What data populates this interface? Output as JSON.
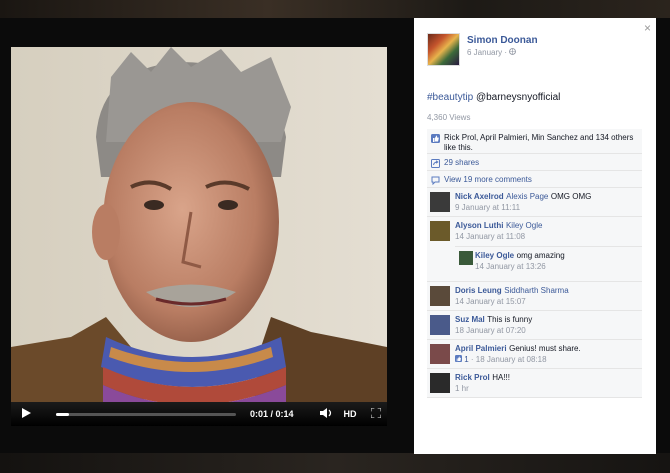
{
  "video": {
    "time": "0:01 / 0:14",
    "progress_fraction": 0.07,
    "hd_label": "HD"
  },
  "panel": {
    "close": "×",
    "author": "Simon Doonan",
    "date": "6 January ·",
    "hashtag": "#beautytip",
    "mention": "@barneysnyofficial",
    "views": "4,360 Views",
    "likes_text": "Rick Prol, April Palmieri, Min Sanchez and 134 others like this.",
    "shares": "29 shares",
    "more_comments": "View 19 more comments",
    "comments": [
      {
        "name": "Nick Axelrod",
        "mention": "Alexis Page",
        "text": "OMG OMG",
        "time": "9 January at 11:11",
        "avatar_color": "#3a3a3a"
      },
      {
        "name": "Alyson Luthi",
        "mention": "Kiley Ogle",
        "text": "",
        "time": "14 January at 11:08",
        "avatar_color": "#6b5a2a"
      },
      {
        "name": "Doris Leung",
        "mention": "Siddharth Sharma",
        "text": "",
        "time": "14 January at 15:07",
        "avatar_color": "#5a4a3a"
      },
      {
        "name": "Suz Mal",
        "mention": "",
        "text": "This is funny",
        "time": "18 January at 07:20",
        "avatar_color": "#4a5a8a"
      },
      {
        "name": "April Palmieri",
        "mention": "",
        "text": "Genius! must share.",
        "likes": "1",
        "time": "· 18 January at 08:18",
        "avatar_color": "#7a4a4a"
      },
      {
        "name": "Rick Prol",
        "mention": "",
        "text": "HA!!!",
        "time": "1 hr",
        "avatar_color": "#2a2a2a"
      }
    ],
    "reply": {
      "name": "Kiley Ogle",
      "text": "omg amazing",
      "time": "14 January at 13:26",
      "avatar_color": "#3a5a3a"
    }
  }
}
